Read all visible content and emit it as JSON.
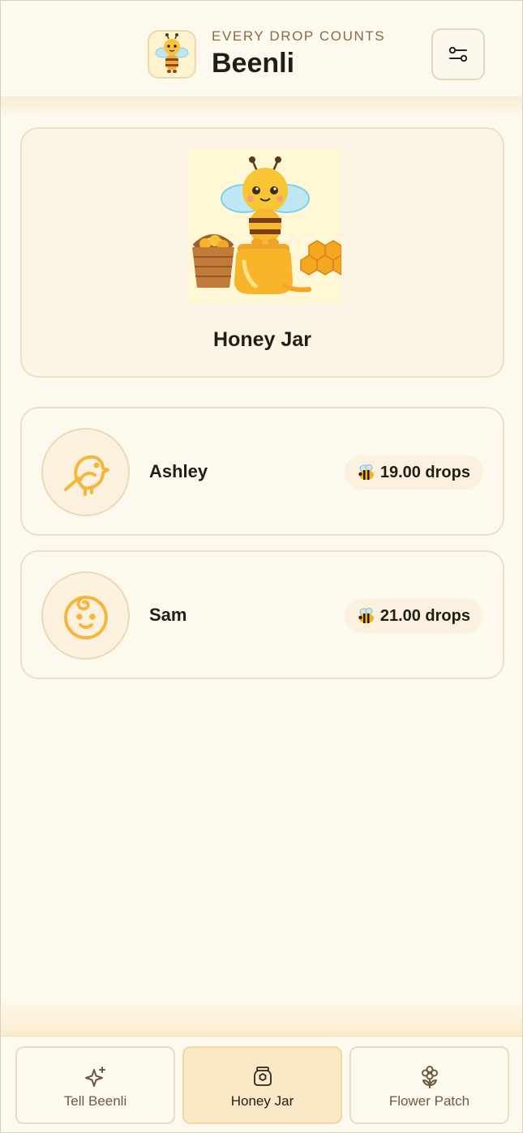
{
  "header": {
    "tagline": "EVERY DROP COUNTS",
    "title": "Beenli",
    "logo_icon": "bee-mascot-icon",
    "settings_icon": "sliders-icon"
  },
  "hero": {
    "title": "Honey Jar",
    "image": "bee-on-honey-jar-illustration"
  },
  "members": [
    {
      "name": "Ashley",
      "avatar_icon": "bird-icon",
      "drops": "19.00 drops",
      "badge_icon": "bee-emoji"
    },
    {
      "name": "Sam",
      "avatar_icon": "baby-face-icon",
      "drops": "21.00 drops",
      "badge_icon": "bee-emoji"
    }
  ],
  "nav": {
    "tabs": [
      {
        "label": "Tell Beenli",
        "icon": "sparkles-icon",
        "active": false
      },
      {
        "label": "Honey Jar",
        "icon": "honey-jar-icon",
        "active": true
      },
      {
        "label": "Flower Patch",
        "icon": "flower-icon",
        "active": false
      }
    ]
  },
  "colors": {
    "background": "#fef9ee",
    "accent": "#f3b72d",
    "text": "#231c17",
    "active_tab": "#fbe9c5"
  }
}
